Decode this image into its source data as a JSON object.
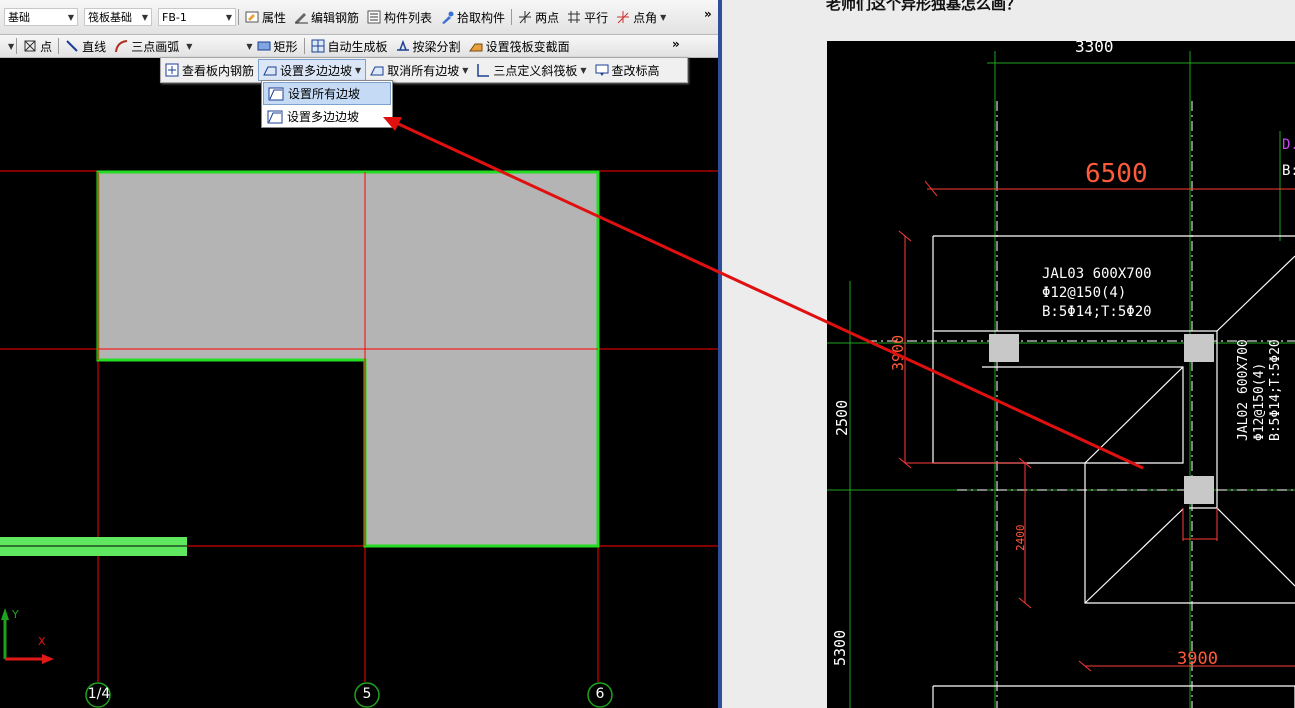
{
  "left_app": {
    "toolbar1": {
      "floor_combo": "基础",
      "type_combo": "筏板基础",
      "element_combo": "FB-1",
      "buttons": [
        "属性",
        "编辑钢筋",
        "构件列表",
        "拾取构件",
        "两点",
        "平行",
        "点角"
      ]
    },
    "toolbar2": {
      "buttons": [
        "点",
        "直线",
        "三点画弧",
        "矩形",
        "自动生成板",
        "按梁分割",
        "设置筏板变截面"
      ]
    },
    "slope_toolbar": {
      "buttons": [
        "查看板内钢筋",
        "设置多边边坡",
        "取消所有边坡",
        "三点定义斜筏板",
        "查改标高"
      ]
    },
    "dropdown_menu": {
      "items": [
        "设置所有边坡",
        "设置多边边坡"
      ],
      "highlighted": "设置所有边坡"
    },
    "axis_labels": [
      "1/4",
      "5",
      "6"
    ],
    "coord_axes": {
      "y": "Y",
      "x": "X"
    },
    "colors": {
      "grid_line": "#ff0000",
      "slab_fill": "#b4b4b4",
      "slab_border": "#22dd22",
      "background": "#000000"
    }
  },
  "right_panel": {
    "question_text": "老师们这个异形独基怎么画？",
    "drawing": {
      "dims": [
        "3300",
        "6500",
        "3900",
        "2500",
        "2400",
        "5300",
        "3900"
      ],
      "beam_label_1": [
        "JAL03 600X700",
        "Φ12@150(4)",
        "B:5Φ14;T:5Φ20"
      ],
      "beam_label_2": [
        "JAL02 600X700",
        "Φ12@150(4)",
        "B:5Φ14;T:5Φ20"
      ],
      "edge_label": [
        "D.",
        "B:"
      ]
    }
  }
}
